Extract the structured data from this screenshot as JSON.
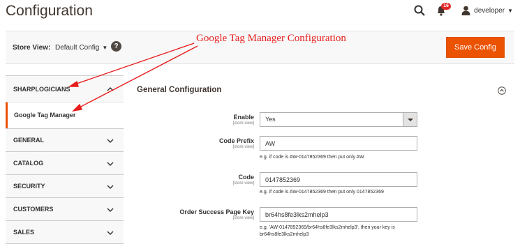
{
  "header": {
    "title": "Configuration",
    "notification_count": "16",
    "username": "developer"
  },
  "actions_bar": {
    "store_view_label": "Store View:",
    "store_view_value": "Default Config",
    "help": "?",
    "save_label": "Save Config"
  },
  "sidebar": {
    "tabs": [
      {
        "label": "SHARPLOGICIANS",
        "expanded": true,
        "items": [
          {
            "label": "Google Tag Manager",
            "active": true
          }
        ]
      },
      {
        "label": "GENERAL",
        "expanded": false
      },
      {
        "label": "CATALOG",
        "expanded": false
      },
      {
        "label": "SECURITY",
        "expanded": false
      },
      {
        "label": "CUSTOMERS",
        "expanded": false
      },
      {
        "label": "SALES",
        "expanded": false
      }
    ]
  },
  "section": {
    "title": "General Configuration",
    "fields": [
      {
        "label": "Enable",
        "scope": "[store view]",
        "value": "Yes",
        "type": "select"
      },
      {
        "label": "Code Prefix",
        "scope": "[store view]",
        "value": "AW",
        "note": "e.g. if code is AW-0147852369 then put only AW"
      },
      {
        "label": "Code",
        "scope": "[store view]",
        "value": "0147852369",
        "note": "e.g. if code is AW-0147852369 then put only 0147852369"
      },
      {
        "label": "Order Success Page Key",
        "scope": "[store view]",
        "value": "br64hs8fe3lks2mhelp3",
        "note_line1": "e.g. 'AW-0147852369/br64hs8fe3lks2mhelp3', then your key is",
        "note_line2": "br64hs8fe3lks2mhelp3"
      }
    ]
  },
  "annotation": {
    "text": "Google Tag Manager Configuration",
    "color": "#e81c1c"
  },
  "colors": {
    "accent": "#eb5202",
    "title": "#41362f"
  }
}
